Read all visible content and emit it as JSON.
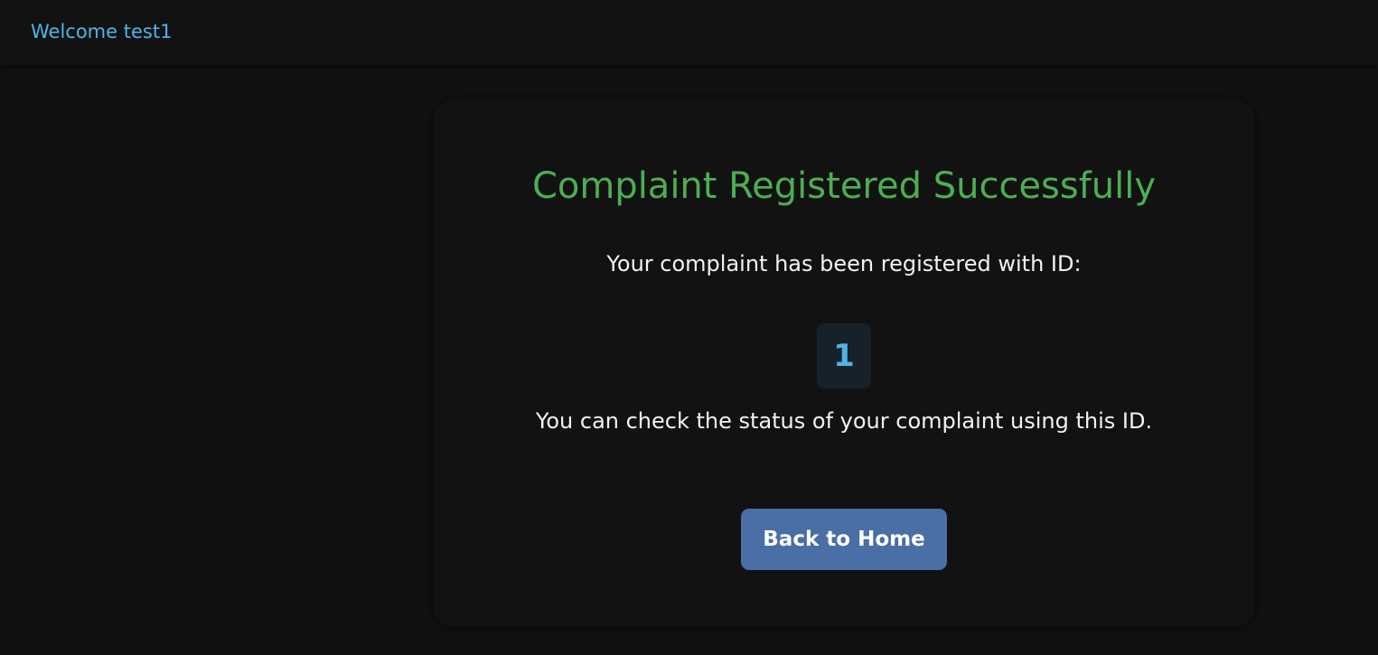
{
  "header": {
    "welcome_text": "Welcome test1"
  },
  "confirmation": {
    "title": "Complaint Registered Successfully",
    "registered_text": "Your complaint has been registered with ID:",
    "complaint_id": "1",
    "status_hint": "You can check the status of your complaint using this ID.",
    "back_button_label": "Back to Home"
  },
  "colors": {
    "background": "#111111",
    "accent_blue": "#4fb3e8",
    "success_green": "#4caf50",
    "button": "#4a6ea6",
    "id_box": "#172129"
  }
}
